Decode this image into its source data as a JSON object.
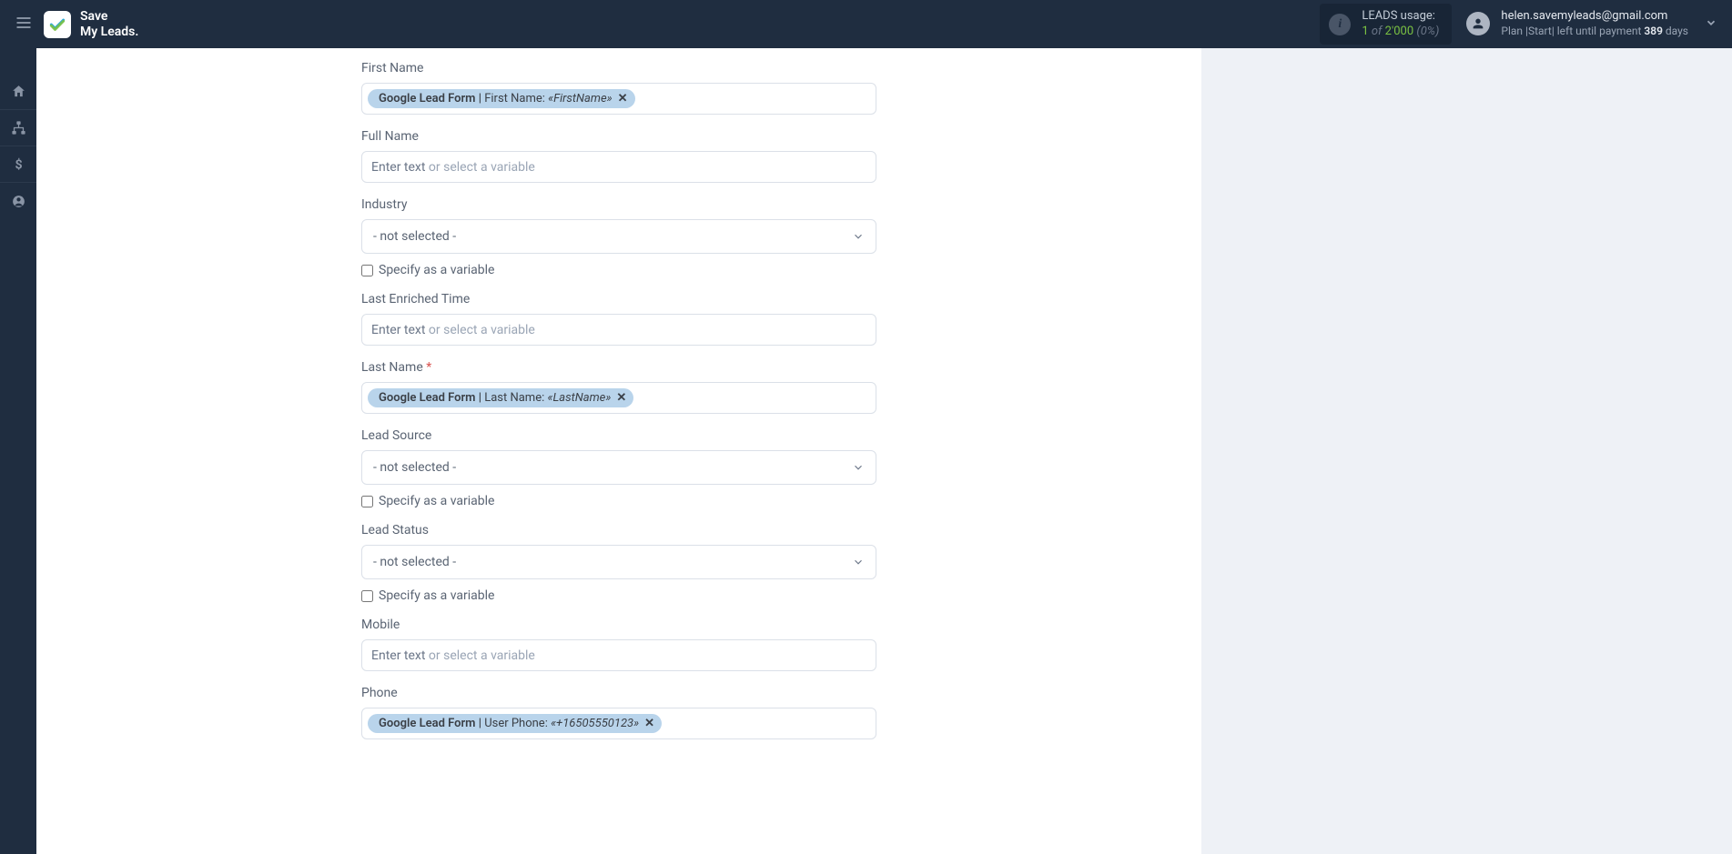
{
  "brand": {
    "line1": "Save",
    "line2": "My Leads."
  },
  "usage": {
    "label": "LEADS usage:",
    "current": "1",
    "of": "of",
    "total": "2'000",
    "pct": "(0%)"
  },
  "user": {
    "email": "helen.savemyleads@gmail.com",
    "plan_prefix": "Plan ",
    "plan_name": "|Start|",
    "plan_mid": " left until payment ",
    "plan_days": "389",
    "plan_suffix": " days"
  },
  "placeholders": {
    "text_or_var_dark": "Enter text",
    "text_or_var_rest": " or select a variable",
    "not_selected": "- not selected -"
  },
  "checkbox_label": "Specify as a variable",
  "fields": {
    "first_name": {
      "label": "First Name",
      "tag_bold": "Google Lead Form | ",
      "tag_mid": "First Name: ",
      "tag_var": "«FirstName»"
    },
    "full_name": {
      "label": "Full Name"
    },
    "industry": {
      "label": "Industry"
    },
    "last_enriched": {
      "label": "Last Enriched Time"
    },
    "last_name": {
      "label": "Last Name",
      "tag_bold": "Google Lead Form | ",
      "tag_mid": "Last Name: ",
      "tag_var": "«LastName»"
    },
    "lead_source": {
      "label": "Lead Source"
    },
    "lead_status": {
      "label": "Lead Status"
    },
    "mobile": {
      "label": "Mobile"
    },
    "phone": {
      "label": "Phone",
      "tag_bold": "Google Lead Form | ",
      "tag_mid": "User Phone: ",
      "tag_var": "«+16505550123»"
    }
  }
}
